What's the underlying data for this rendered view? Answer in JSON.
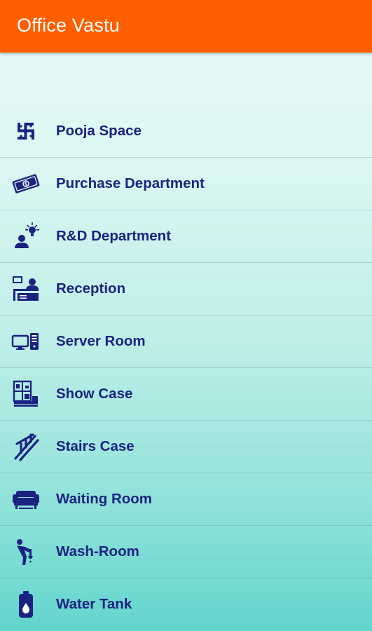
{
  "appbar": {
    "title": "Office Vastu",
    "color": "#ff5f00"
  },
  "theme": {
    "text_color": "#1b2380",
    "icon_color": "#1b2380"
  },
  "items": [
    {
      "label": "Pooja Space",
      "icon": "swastika-icon"
    },
    {
      "label": "Purchase Department",
      "icon": "money-icon"
    },
    {
      "label": "R&D Department",
      "icon": "idea-person-icon"
    },
    {
      "label": "Reception",
      "icon": "reception-desk-icon"
    },
    {
      "label": "Server Room",
      "icon": "computer-server-icon"
    },
    {
      "label": "Show Case",
      "icon": "showcase-shelf-icon"
    },
    {
      "label": "Stairs Case",
      "icon": "staircase-icon"
    },
    {
      "label": "Waiting Room",
      "icon": "sofa-icon"
    },
    {
      "label": "Wash-Room",
      "icon": "washroom-person-icon"
    },
    {
      "label": "Water Tank",
      "icon": "water-tank-icon"
    }
  ]
}
